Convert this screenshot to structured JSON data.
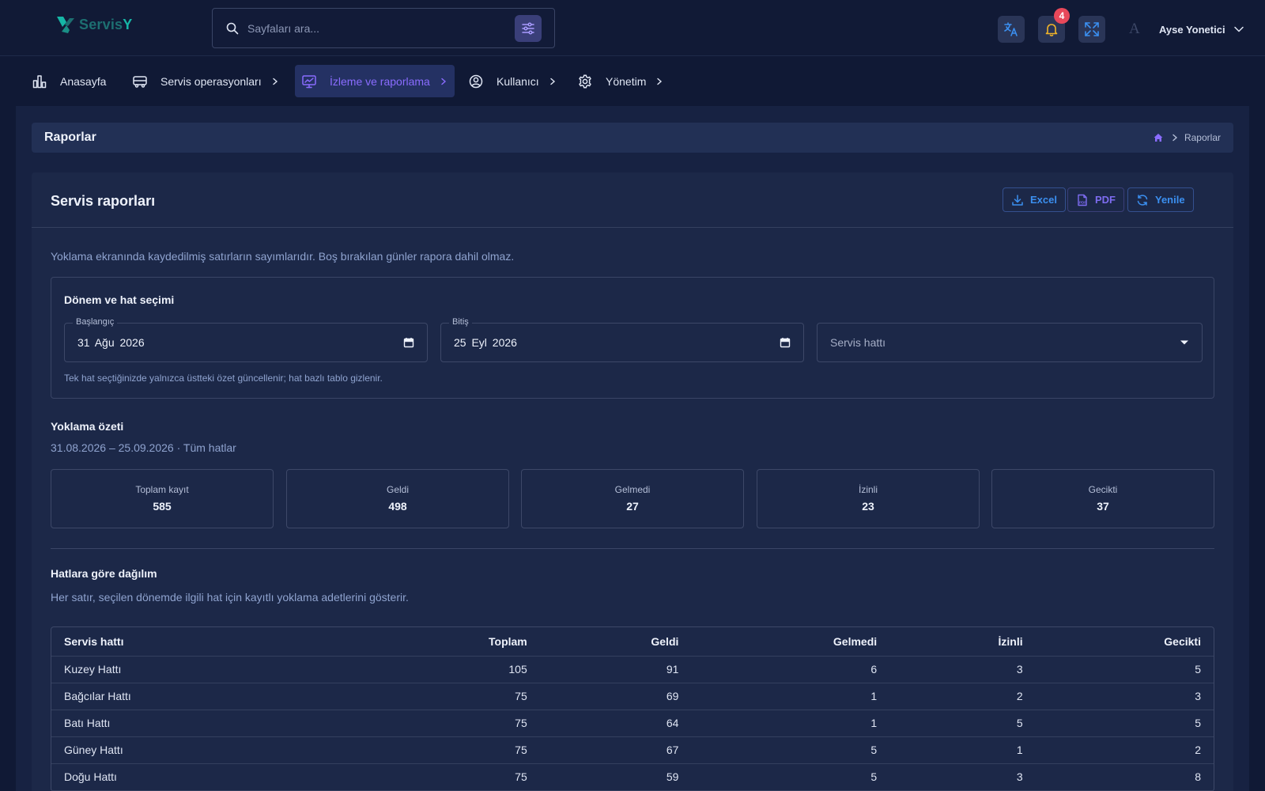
{
  "app": {
    "logo_text": "Servis",
    "logo_accent": "Y",
    "brand_color": "#16b6a6"
  },
  "search": {
    "placeholder": "Sayfaları ara..."
  },
  "header": {
    "notification_count": "4",
    "user_initial": "A",
    "user_name": "Ayse Yonetici"
  },
  "nav": {
    "items": [
      {
        "label": "Anasayfa",
        "icon": "bar-chart-icon"
      },
      {
        "label": "Servis operasyonları",
        "icon": "bus-icon"
      },
      {
        "label": "İzleme ve raporlama",
        "icon": "monitor-chart-icon",
        "active": true
      },
      {
        "label": "Kullanıcı",
        "icon": "user-circle-icon"
      },
      {
        "label": "Yönetim",
        "icon": "gear-icon"
      }
    ]
  },
  "page": {
    "title": "Raporlar",
    "breadcrumb_current": "Raporlar"
  },
  "card": {
    "title": "Servis raporları",
    "buttons": {
      "excel": "Excel",
      "pdf": "PDF",
      "refresh": "Yenile"
    },
    "description": "Yoklama ekranında kaydedilmiş satırların sayımlarıdır. Boş bırakılan günler rapora dahil olmaz."
  },
  "filters": {
    "title": "Dönem ve hat seçimi",
    "start_label": "Başlangıç",
    "start_value": "31 Ağu 2026",
    "end_label": "Bitiş",
    "end_value": "25 Eyl 2026",
    "line_placeholder": "Servis hattı",
    "hint": "Tek hat seçtiğinizde yalnızca üstteki özet güncellenir; hat bazlı tablo gizlenir."
  },
  "summary": {
    "title": "Yoklama özeti",
    "subtitle": "31.08.2026 – 25.09.2026 · Tüm hatlar",
    "stats": [
      {
        "label": "Toplam kayıt",
        "value": "585"
      },
      {
        "label": "Geldi",
        "value": "498"
      },
      {
        "label": "Gelmedi",
        "value": "27"
      },
      {
        "label": "İzinli",
        "value": "23"
      },
      {
        "label": "Gecikti",
        "value": "37"
      }
    ]
  },
  "distribution": {
    "title": "Hatlara göre dağılım",
    "subtitle": "Her satır, seçilen dönemde ilgili hat için kayıtlı yoklama adetlerini gösterir.",
    "columns": [
      "Servis hattı",
      "Toplam",
      "Geldi",
      "Gelmedi",
      "İzinli",
      "Gecikti"
    ],
    "rows": [
      [
        "Kuzey Hattı",
        "105",
        "91",
        "6",
        "3",
        "5"
      ],
      [
        "Bağcılar Hattı",
        "75",
        "69",
        "1",
        "2",
        "3"
      ],
      [
        "Batı Hattı",
        "75",
        "64",
        "1",
        "5",
        "5"
      ],
      [
        "Güney Hattı",
        "75",
        "67",
        "5",
        "1",
        "2"
      ],
      [
        "Doğu Hattı",
        "75",
        "59",
        "5",
        "3",
        "8"
      ]
    ]
  }
}
